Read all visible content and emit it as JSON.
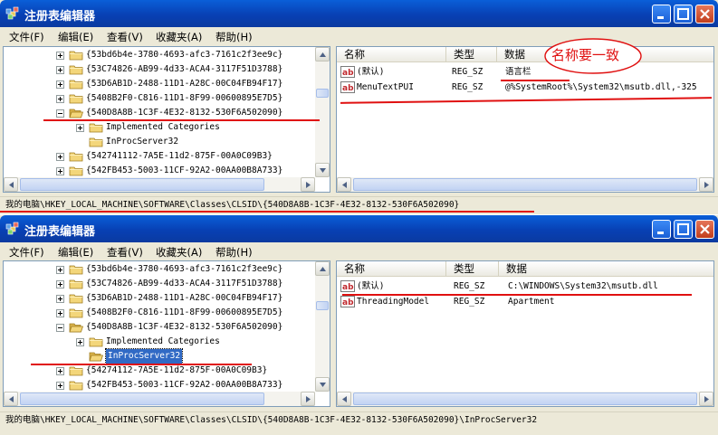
{
  "windows": [
    {
      "title": "注册表编辑器",
      "menu": [
        "文件(F)",
        "编辑(E)",
        "查看(V)",
        "收藏夹(A)",
        "帮助(H)"
      ],
      "tree": [
        {
          "label": "{53bd6b4e-3780-4693-afc3-7161c2f3ee9c}",
          "level": 1,
          "toggle": "plus",
          "open": false,
          "selected": false
        },
        {
          "label": "{53C74826-AB99-4d33-ACA4-3117F51D3788}",
          "level": 1,
          "toggle": "plus",
          "open": false,
          "selected": false
        },
        {
          "label": "{53D6AB1D-2488-11D1-A28C-00C04FB94F17}",
          "level": 1,
          "toggle": "plus",
          "open": false,
          "selected": false
        },
        {
          "label": "{5408B2F0-C816-11D1-8F99-00600895E7D5}",
          "level": 1,
          "toggle": "plus",
          "open": false,
          "selected": false
        },
        {
          "label": "{540D8A8B-1C3F-4E32-8132-530F6A502090}",
          "level": 1,
          "toggle": "minus",
          "open": true,
          "selected": false
        },
        {
          "label": "Implemented Categories",
          "level": 2,
          "toggle": "plus",
          "open": false,
          "selected": false
        },
        {
          "label": "InProcServer32",
          "level": 2,
          "toggle": "none",
          "open": false,
          "selected": false
        },
        {
          "label": "{542741112-7A5E-11d2-875F-00A0C09B3}",
          "level": 1,
          "toggle": "plus",
          "open": false,
          "selected": false
        },
        {
          "label": "{542FB453-5003-11CF-92A2-00AA00B8A733}",
          "level": 1,
          "toggle": "plus",
          "open": false,
          "selected": false
        }
      ],
      "columns": [
        "名称",
        "类型",
        "数据"
      ],
      "values": [
        {
          "name": "(默认)",
          "type": "REG_SZ",
          "data": "语言栏",
          "icon": "string-value-icon"
        },
        {
          "name": "MenuTextPUI",
          "type": "REG_SZ",
          "data": "@%SystemRoot%\\System32\\msutb.dll,-325",
          "icon": "string-value-icon"
        }
      ],
      "status": "我的电脑\\HKEY_LOCAL_MACHINE\\SOFTWARE\\Classes\\CLSID\\{540D8A8B-1C3F-4E32-8132-530F6A502090}",
      "annotation": "名称要一致"
    },
    {
      "title": "注册表编辑器",
      "menu": [
        "文件(F)",
        "编辑(E)",
        "查看(V)",
        "收藏夹(A)",
        "帮助(H)"
      ],
      "tree": [
        {
          "label": "{53bd6b4e-3780-4693-afc3-7161c2f3ee9c}",
          "level": 1,
          "toggle": "plus",
          "open": false,
          "selected": false
        },
        {
          "label": "{53C74826-AB99-4d33-ACA4-3117F51D3788}",
          "level": 1,
          "toggle": "plus",
          "open": false,
          "selected": false
        },
        {
          "label": "{53D6AB1D-2488-11D1-A28C-00C04FB94F17}",
          "level": 1,
          "toggle": "plus",
          "open": false,
          "selected": false
        },
        {
          "label": "{5408B2F0-C816-11D1-8F99-00600895E7D5}",
          "level": 1,
          "toggle": "plus",
          "open": false,
          "selected": false
        },
        {
          "label": "{540D8A8B-1C3F-4E32-8132-530F6A502090}",
          "level": 1,
          "toggle": "minus",
          "open": true,
          "selected": false
        },
        {
          "label": "Implemented Categories",
          "level": 2,
          "toggle": "plus",
          "open": false,
          "selected": false
        },
        {
          "label": "InProcServer32",
          "level": 2,
          "toggle": "none",
          "open": true,
          "selected": true
        },
        {
          "label": "{54274112-7A5E-11d2-875F-00A0C09B3}",
          "level": 1,
          "toggle": "plus",
          "open": false,
          "selected": false
        },
        {
          "label": "{542FB453-5003-11CF-92A2-00AA00B8A733}",
          "level": 1,
          "toggle": "plus",
          "open": false,
          "selected": false
        }
      ],
      "columns": [
        "名称",
        "类型",
        "数据"
      ],
      "values": [
        {
          "name": "(默认)",
          "type": "REG_SZ",
          "data": "C:\\WINDOWS\\System32\\msutb.dll",
          "icon": "string-value-icon"
        },
        {
          "name": "ThreadingModel",
          "type": "REG_SZ",
          "data": "Apartment",
          "icon": "string-value-icon"
        }
      ],
      "status": "我的电脑\\HKEY_LOCAL_MACHINE\\SOFTWARE\\Classes\\CLSID\\{540D8A8B-1C3F-4E32-8132-530F6A502090}\\InProcServer32"
    }
  ],
  "colors": {
    "titlebar": "#0a4fc8",
    "selection": "#316ac5",
    "annotation_red": "#e01010",
    "folder": "#f3d67a",
    "window_bg": "#ece9d8"
  }
}
